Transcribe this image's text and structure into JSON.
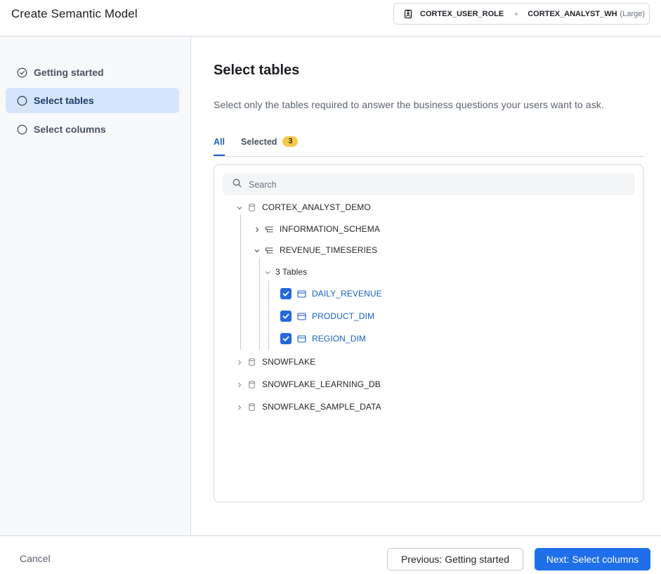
{
  "header": {
    "title": "Create Semantic Model",
    "role": "CORTEX_USER_ROLE",
    "warehouse": "CORTEX_ANALYST_WH",
    "warehouse_size": "(Large)"
  },
  "sidebar": {
    "steps": [
      {
        "label": "Getting started",
        "state": "completed",
        "icon": "check-circle-icon"
      },
      {
        "label": "Select tables",
        "state": "active",
        "icon": "circle-icon"
      },
      {
        "label": "Select columns",
        "state": "pending",
        "icon": "circle-icon"
      }
    ]
  },
  "main": {
    "title": "Select tables",
    "description": "Select only the tables required to answer the business questions your users want to ask.",
    "tabs": {
      "all_label": "All",
      "selected_label": "Selected",
      "selected_count": "3"
    },
    "search": {
      "placeholder": "Search",
      "value": ""
    },
    "tree": {
      "databases": [
        "CORTEX_ANALYST_DEMO",
        "SNOWFLAKE",
        "SNOWFLAKE_LEARNING_DB",
        "SNOWFLAKE_SAMPLE_DATA"
      ],
      "schemas": [
        "INFORMATION_SCHEMA",
        "REVENUE_TIMESERIES"
      ],
      "tables_group": "3 Tables",
      "tables": [
        "DAILY_REVENUE",
        "PRODUCT_DIM",
        "REGION_DIM"
      ]
    }
  },
  "footer": {
    "cancel_label": "Cancel",
    "prev_label": "Previous: Getting started",
    "next_label": "Next: Select columns"
  },
  "colors": {
    "accent": "#1f6feb",
    "active_step_bg": "#d6e5fb",
    "badge": "#f7c948",
    "table_link": "#1b5fc7"
  }
}
